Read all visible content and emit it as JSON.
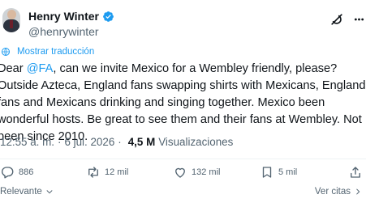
{
  "author": {
    "display_name": "Henry Winter",
    "handle": "@henrywinter"
  },
  "translate_label": "Mostrar traducción",
  "tweet": {
    "text_before": "Dear ",
    "mention": "@FA",
    "text_after": ", can we invite Mexico for a Wembley friendly, please? Outside Azteca, England fans swapping shirts with Mexicans, England fans and Mexicans drinking and singing together. Mexico been wonderful hosts. Be great to see them and their fans at Wembley. Not been since 2010."
  },
  "meta": {
    "time": "12:55 a. m.",
    "separator": "·",
    "date": "6 jul. 2026",
    "views_count": "4,5 M",
    "views_label": "Visualizaciones"
  },
  "actions": {
    "replies": "886",
    "reposts": "12 mil",
    "likes": "132 mil",
    "bookmarks": "5 mil"
  },
  "footer": {
    "sort_label": "Relevante",
    "quotes_label": "Ver citas"
  },
  "colors": {
    "accent": "#1d9bf0",
    "text": "#0f1419",
    "muted": "#536471",
    "divider": "#eff3f4"
  }
}
